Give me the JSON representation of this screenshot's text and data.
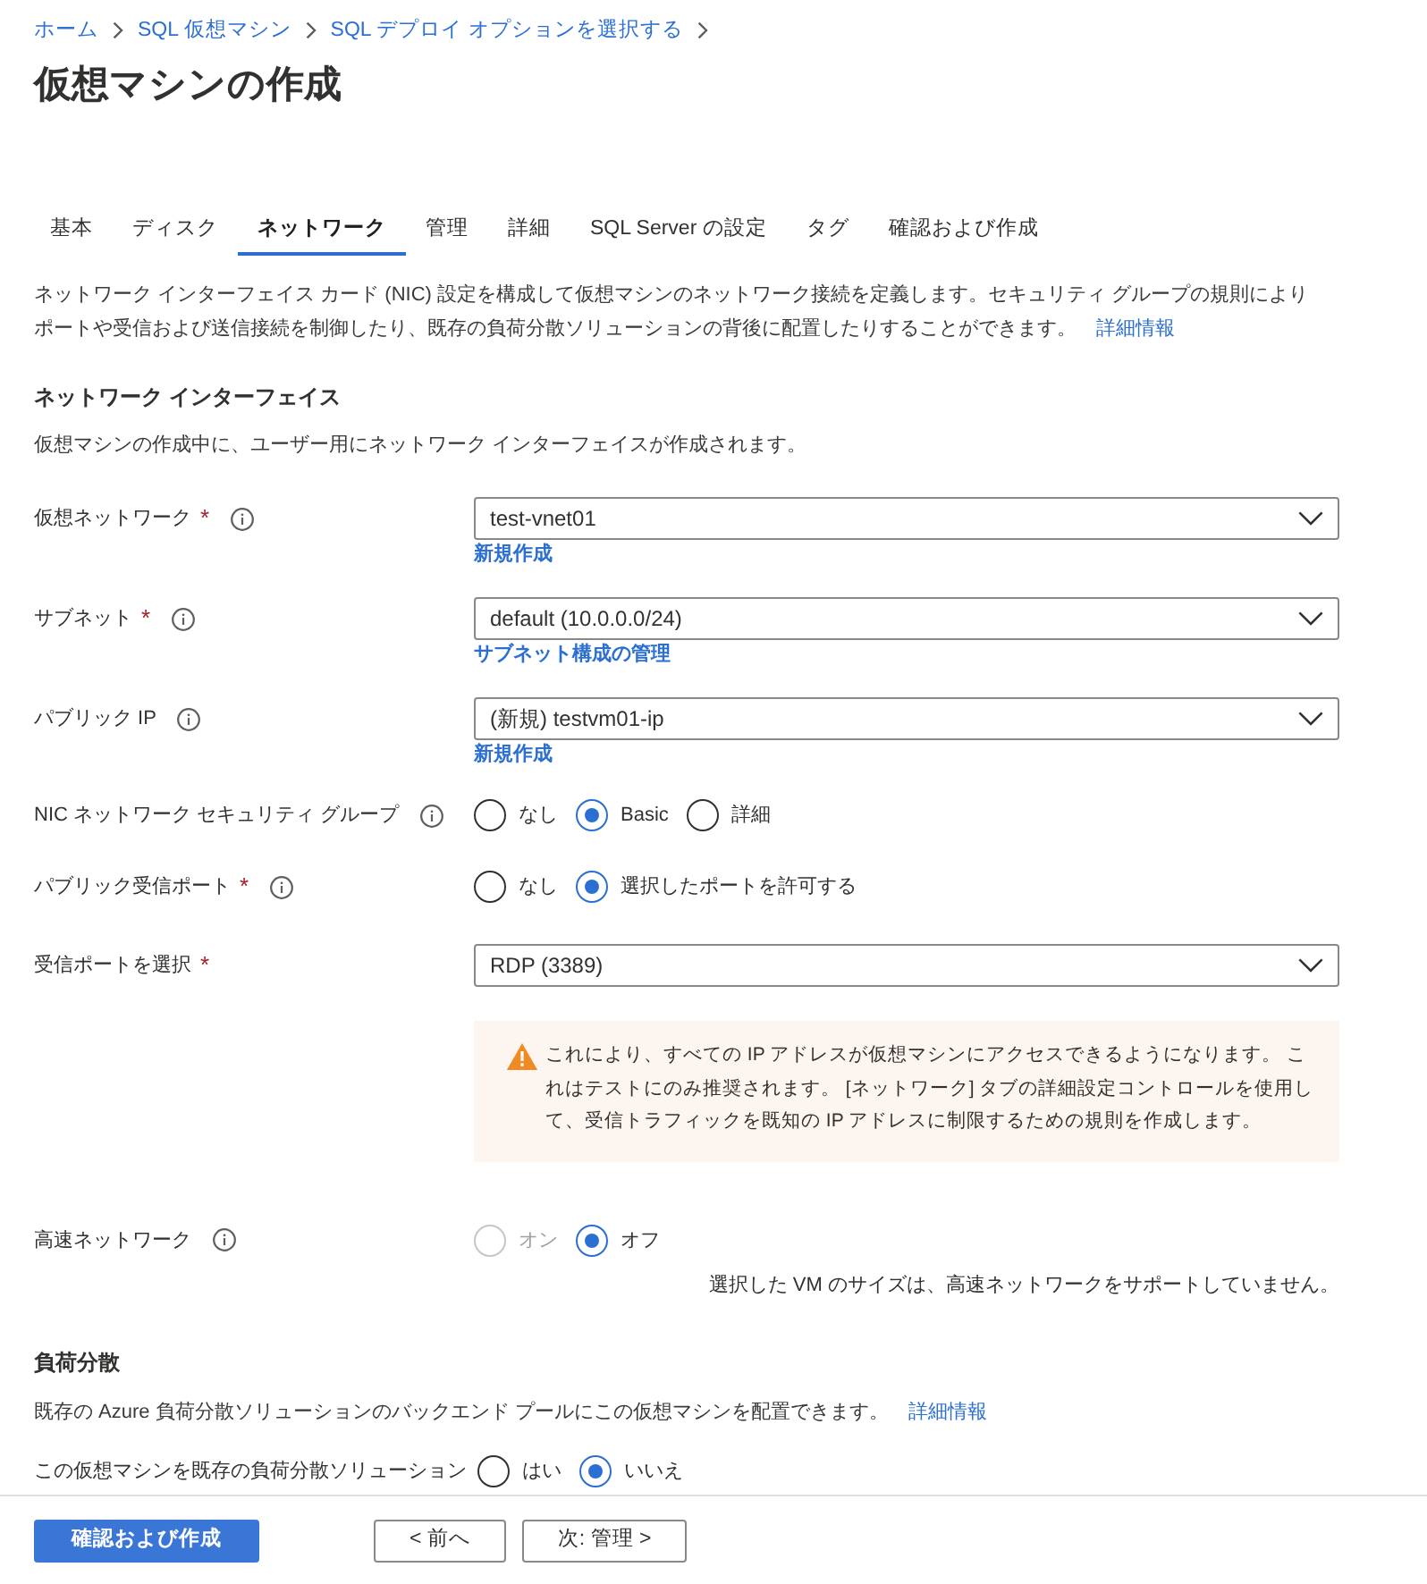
{
  "breadcrumb": [
    {
      "label": "ホーム"
    },
    {
      "label": "SQL 仮想マシン"
    },
    {
      "label": "SQL デプロイ オプションを選択する"
    }
  ],
  "title": "仮想マシンの作成",
  "tabs": [
    {
      "label": "基本",
      "selected": false
    },
    {
      "label": "ディスク",
      "selected": false
    },
    {
      "label": "ネットワーク",
      "selected": true
    },
    {
      "label": "管理",
      "selected": false
    },
    {
      "label": "詳細",
      "selected": false
    },
    {
      "label": "SQL Server の設定",
      "selected": false
    },
    {
      "label": "タグ",
      "selected": false
    },
    {
      "label": "確認および作成",
      "selected": false
    }
  ],
  "intro": {
    "text": "ネットワーク インターフェイス カード (NIC) 設定を構成して仮想マシンのネットワーク接続を定義します。セキュリティ グループの規則によりポートや受信および送信接続を制御したり、既存の負荷分散ソリューションの背後に配置したりすることができます。",
    "link": "詳細情報"
  },
  "sections": [
    {
      "heading": "ネットワーク インターフェイス",
      "description": "仮想マシンの作成中に、ユーザー用にネットワーク インターフェイスが作成されます。",
      "fields": [
        {
          "kind": "select",
          "label": "仮想ネットワーク",
          "required_mark": "*",
          "info": true,
          "value": "test-vnet01",
          "link": "新規作成"
        },
        {
          "kind": "select",
          "label": "サブネット",
          "required_mark": "*",
          "info": true,
          "value": "default (10.0.0.0/24)",
          "link": "サブネット構成の管理"
        },
        {
          "kind": "select",
          "label": "パブリック IP",
          "info": true,
          "value": "(新規) testvm01-ip",
          "link": "新規作成"
        },
        {
          "kind": "radio",
          "label": "NIC ネットワーク セキュリティ グループ",
          "info": true,
          "options": [
            {
              "label": "なし",
              "selected": false,
              "disabled": false
            },
            {
              "label": "Basic",
              "selected": true,
              "disabled": false
            },
            {
              "label": "詳細",
              "selected": false,
              "disabled": false
            }
          ]
        },
        {
          "kind": "radio",
          "label": "パブリック受信ポート",
          "required_mark": "*",
          "info": true,
          "options": [
            {
              "label": "なし",
              "selected": false,
              "disabled": false
            },
            {
              "label": "選択したポートを許可する",
              "selected": true,
              "disabled": false
            }
          ]
        },
        {
          "kind": "select",
          "label": "受信ポートを選択",
          "required_mark": "*",
          "info": false,
          "value": "RDP (3389)"
        },
        {
          "kind": "warning",
          "text": "これにより、すべての IP アドレスが仮想マシンにアクセスできるようになります。 これはテストにのみ推奨されます。 [ネットワーク] タブの詳細設定コントロールを使用して、受信トラフィックを既知の IP アドレスに制限するための規則を作成します。"
        },
        {
          "kind": "radio",
          "label": "高速ネットワーク",
          "info": true,
          "options": [
            {
              "label": "オン",
              "selected": false,
              "disabled": true
            },
            {
              "label": "オフ",
              "selected": true,
              "disabled": false
            }
          ],
          "note": "選択した VM のサイズは、高速ネットワークをサポートしていません。"
        }
      ]
    },
    {
      "heading": "負荷分散",
      "description": "既存の Azure 負荷分散ソリューションのバックエンド プールにこの仮想マシンを配置できます。",
      "link": "詳細情報",
      "fields": [
        {
          "kind": "radio",
          "label": "この仮想マシンを既存の負荷分散ソリューション",
          "info": false,
          "options": [
            {
              "label": "はい",
              "selected": false,
              "disabled": false
            },
            {
              "label": "いいえ",
              "selected": true,
              "disabled": false
            }
          ]
        }
      ]
    }
  ],
  "footer": {
    "buttons": [
      {
        "label": "確認および作成",
        "kind": "primary"
      },
      {
        "label": "< 前へ",
        "kind": "secondary"
      },
      {
        "label": "次: 管理 >",
        "kind": "secondary"
      }
    ]
  }
}
